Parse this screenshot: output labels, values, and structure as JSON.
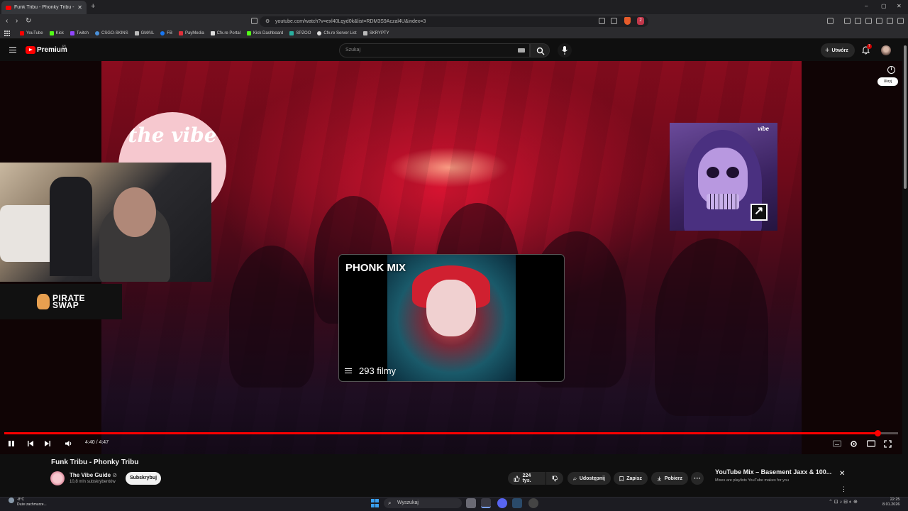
{
  "browser": {
    "tab_title": "Funk Tribu - Phonky Tribu - Y...",
    "new_tab": "+",
    "url": "youtube.com/watch?v=exl40Lqyd0k&list=RDM3S9Aczal4U&index=3",
    "extension_badge": "2",
    "window_controls": [
      "–",
      "▢",
      "✕"
    ],
    "nav": {
      "back": "‹",
      "forward": "›",
      "reload": "↻"
    },
    "bookmarks": [
      {
        "label": "YouTube",
        "color": "#ff0000"
      },
      {
        "label": "Kick",
        "color": "#53fc18"
      },
      {
        "label": "Twitch",
        "color": "#9146ff"
      },
      {
        "label": "CSGO-SKINS",
        "color": "#4a90d9"
      },
      {
        "label": "GMAIL",
        "color": "#bbbbbb"
      },
      {
        "label": "FB",
        "color": "#1877f2"
      },
      {
        "label": "PayMedia",
        "color": "#e0303a"
      },
      {
        "label": "Cfx.re Portal",
        "color": "#dddddd"
      },
      {
        "label": "Kick Dashboard",
        "color": "#53fc18"
      },
      {
        "label": "SPZOO",
        "color": "#2ab0a0"
      },
      {
        "label": "Cfx.re Server List",
        "color": "#dddddd"
      },
      {
        "label": "SKRYPTY",
        "color": "#bbbbbb"
      }
    ]
  },
  "youtube": {
    "logo_text": "Premium",
    "region": "PL",
    "search_placeholder": "Szukaj",
    "create_label": "Utwórz",
    "notif_count": "7"
  },
  "player": {
    "playlist_card": {
      "title": "PHONK MIX",
      "count": "293 filmy"
    },
    "hide_label": "Ukryj",
    "pirate_text_1": "PIRATE",
    "pirate_text_2": "SWAP",
    "vibe_text": "the vibe",
    "skull_badge": "vibe",
    "time_current": "4:40",
    "time_total": "4:47",
    "time_display": "4:40 / 4:47",
    "progress": 0.977
  },
  "video": {
    "title": "Funk Tribu - Phonky Tribu",
    "channel": "The Vibe Guide",
    "verified": "⊘",
    "subscribers": "10,8 mln subskrybentów",
    "subscribe_label": "Subskrybuj",
    "likes": "224 tys.",
    "share_label": "Udostępnij",
    "save_label": "Zapisz",
    "download_label": "Pobierz",
    "more": "···"
  },
  "mix_card": {
    "title": "YouTube Mix – Basement Jaxx & 100...",
    "subtitle": "Mixes are playlists YouTube makes for you",
    "close": "✕",
    "more": "⋮"
  },
  "taskbar": {
    "temperature": "-8°C",
    "weather_desc": "Duże zachmurze...",
    "search_label": "Wyszukaj",
    "time": "22:25",
    "date": "8.01.2026"
  }
}
